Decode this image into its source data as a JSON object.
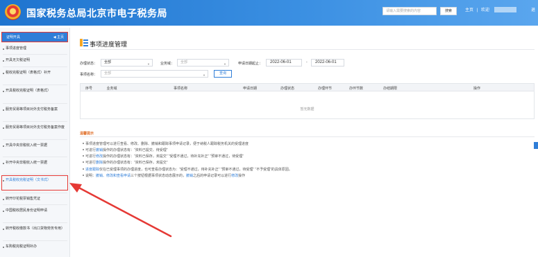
{
  "header": {
    "site_title": "国家税务总局北京市电子税务局",
    "search_placeholder": "请输入需要搜索的内容",
    "search_button": "搜索",
    "home_link": "主页",
    "welcome": "欢迎",
    "right_text": "退"
  },
  "sidebar": {
    "header_label": "证明开具",
    "home_label": "主页",
    "items": [
      "事项进度管理",
      "开具无欠税证明",
      "税收完税证明（表格式）补开",
      "开具税收完税证明（表格式）",
      "服务贸易等项目对外支付税务备案",
      "服务贸易等项目对外支付税务备案作废",
      "开具中央非税收入统一票据",
      "补开中央非税收入统一票据",
      "开具税收完税证明（文书式）",
      "转开印花税票销售凭证",
      "中国税收居民身份证明申请",
      "转开税收缴款书（出口货物劳务专用）",
      "车购税完税证明补办"
    ]
  },
  "page": {
    "title": "事项进度管理"
  },
  "filters": {
    "status_label": "办理状态：",
    "status_value": "全部",
    "domain_label": "业务域：",
    "domain_placeholder": "全部",
    "date_label": "申请日期起止：",
    "date_from": "2022-06-01",
    "date_sep": "-",
    "date_to": "2022-06-01",
    "name_label": "事项名称：",
    "name_placeholder": "全部",
    "query_button": "查询"
  },
  "table": {
    "columns": [
      "序号",
      "业务域",
      "事项名称",
      "申请日期",
      "办理状态",
      "办理环节",
      "办环节数",
      "办结期限",
      "操作"
    ],
    "empty_text": "暂无数据"
  },
  "tips": {
    "title": "温馨提示",
    "lines": [
      [
        "事项进度管理可以进行查看、修改、删除、撤销和跟踪事项申请记录，便于纳税人跟踪税务机关的受理进度",
        ""
      ],
      [
        "可进行",
        "撤销",
        "操作的办理状态有：“资料已提交、待受理”"
      ],
      [
        "可进行",
        "修改",
        "操作的办理状态有：“资料已保存，未提交”  “受理不通过，待补充补正”  “预审不通过，待受理”"
      ],
      [
        "可进行",
        "删除",
        "操作的办理状态有：“资料已保存，未提交”"
      ],
      [
        "",
        "进度跟踪",
        "仅在已受理事项的办理进度，也可查看办理状态为：“受理不通过，待补充补正”  “预审不通过，待受理”  “不予受理”的具体原因。"
      ],
      [
        "说明：",
        "撤销、修改和查看申请",
        "三个按钮根据事项状态动态展示的，",
        "撤销",
        "之后的申请记录可以进行",
        "修改",
        "操作"
      ]
    ]
  },
  "colors": {
    "header_bg": "#2f7ed8",
    "accent": "#2f7ed8",
    "highlight_border": "#e53935",
    "tip_title": "#e0702b"
  }
}
